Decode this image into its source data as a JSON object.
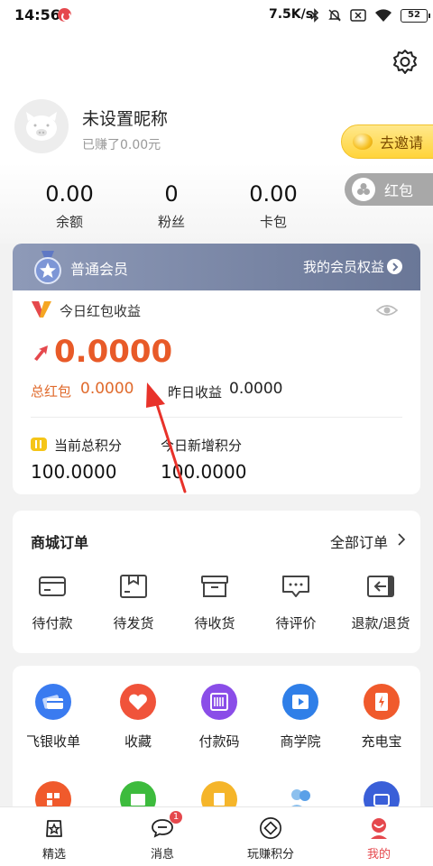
{
  "status_bar": {
    "time": "14:56",
    "network_speed": "7.5K/s",
    "battery": "52"
  },
  "profile": {
    "nickname": "未设置昵称",
    "earned": "已赚了0.00元"
  },
  "header_buttons": {
    "invite": "去邀请",
    "redpack": "红包"
  },
  "stats": [
    {
      "value": "0.00",
      "label": "余额"
    },
    {
      "value": "0",
      "label": "粉丝"
    },
    {
      "value": "0.00",
      "label": "卡包"
    }
  ],
  "member": {
    "title": "普通会员",
    "benefits": "我的会员权益"
  },
  "earnings": {
    "title": "今日红包收益",
    "today_value": "0.0000",
    "total_label": "总红包",
    "total_value": "0.0000",
    "yesterday_label": "昨日收益",
    "yesterday_value": "0.0000",
    "points_label": "当前总积分",
    "points_value": "100.0000",
    "new_points_label": "今日新增积分",
    "new_points_value": "100.0000"
  },
  "orders": {
    "title": "商城订单",
    "all": "全部订单",
    "items": [
      {
        "label": "待付款",
        "icon": "card-icon"
      },
      {
        "label": "待发货",
        "icon": "package-icon"
      },
      {
        "label": "待收货",
        "icon": "box-icon"
      },
      {
        "label": "待评价",
        "icon": "comment-icon"
      },
      {
        "label": "退款/退货",
        "icon": "return-icon"
      }
    ]
  },
  "tools": [
    {
      "label": "飞银收单",
      "color": "#3a7bf0"
    },
    {
      "label": "收藏",
      "color": "#f0533a"
    },
    {
      "label": "付款码",
      "color": "#8a4de8"
    },
    {
      "label": "商学院",
      "color": "#2f7fe8"
    },
    {
      "label": "充电宝",
      "color": "#f05a2c"
    }
  ],
  "tools_row2_colors": [
    "#f05a2c",
    "#3dbb3d",
    "#f5b52a",
    "#5aa0e8",
    "#3a5fd8"
  ],
  "nav": [
    {
      "label": "精选",
      "icon": "star-bag-icon"
    },
    {
      "label": "消息",
      "icon": "message-icon",
      "badge": "1"
    },
    {
      "label": "玩赚积分",
      "icon": "diamond-icon"
    },
    {
      "label": "我的",
      "icon": "profile-icon"
    }
  ],
  "colors": {
    "accent": "#e85a28",
    "nav_active": "#e5484d"
  }
}
